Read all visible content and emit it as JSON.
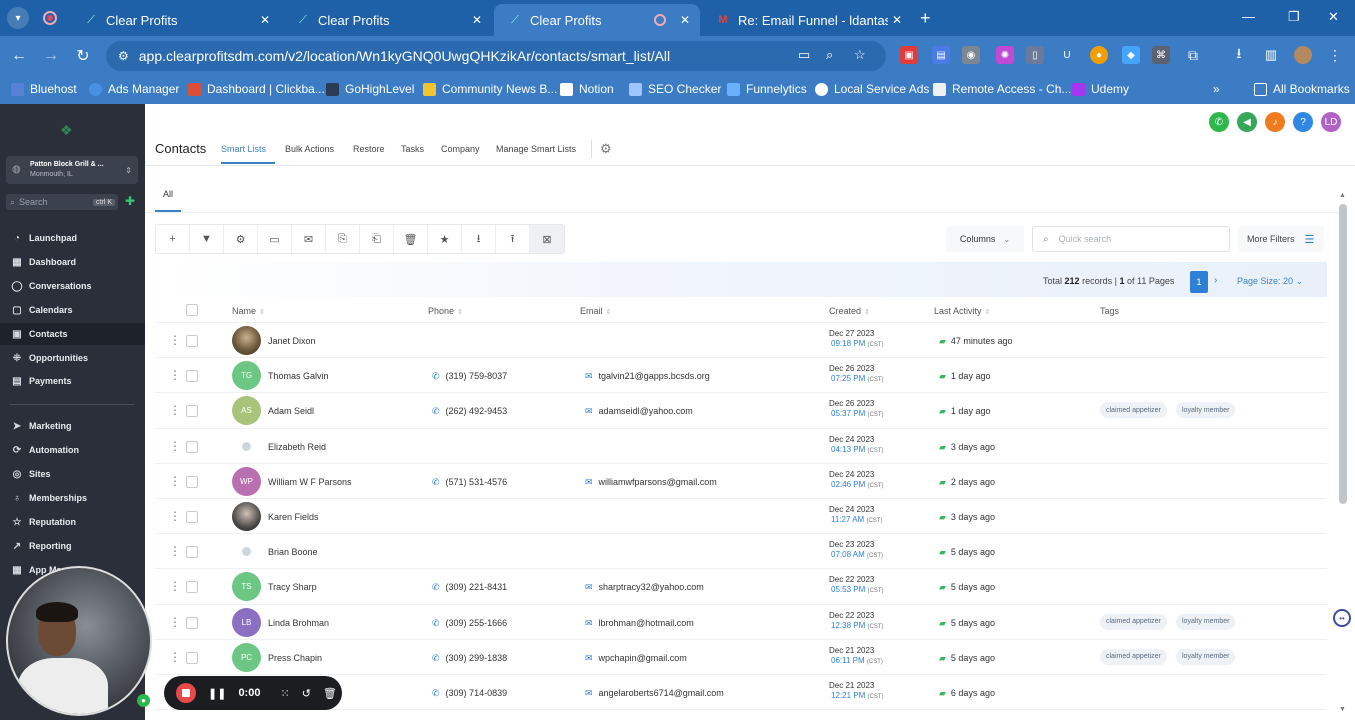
{
  "browser": {
    "tabs": [
      {
        "title": "Clear Profits",
        "active": false
      },
      {
        "title": "Clear Profits",
        "active": false
      },
      {
        "title": "Clear Profits",
        "active": true
      },
      {
        "title": "Re: Email Funnel - ldantas@clea",
        "active": false
      }
    ],
    "url": "app.clearprofitsdm.com/v2/location/Wn1kyGNQ0UwgQHKzikAr/contacts/smart_list/All",
    "bookmarks": [
      {
        "label": "Bluehost",
        "color": "#5a7fd6"
      },
      {
        "label": "Ads Manager",
        "color": "#4a90e2"
      },
      {
        "label": "Dashboard | Clickba...",
        "color": "#d94f3a"
      },
      {
        "label": "GoHighLevel",
        "color": "#2b3a55"
      },
      {
        "label": "Community News B...",
        "color": "#f1c232"
      },
      {
        "label": "Notion",
        "color": "#ffffff"
      },
      {
        "label": "SEO Checker",
        "color": "#9fc4ff"
      },
      {
        "label": "Funnelytics",
        "color": "#6ab0ff"
      },
      {
        "label": "Local Service Ads",
        "color": "#ffffff"
      },
      {
        "label": "Remote Access - Ch...",
        "color": "#f0f0f0"
      },
      {
        "label": "Udemy",
        "color": "#a435f0"
      }
    ],
    "all_bookmarks": "All Bookmarks"
  },
  "sidebar": {
    "location_name": "Patton Block Grill & ...",
    "location_city": "Monmouth, IL",
    "search_placeholder": "Search",
    "search_shortcut": "ctrl K",
    "items": [
      {
        "label": "Launchpad",
        "icon": "rocket-icon"
      },
      {
        "label": "Dashboard",
        "icon": "grid-icon"
      },
      {
        "label": "Conversations",
        "icon": "chat-icon"
      },
      {
        "label": "Calendars",
        "icon": "calendar-icon"
      },
      {
        "label": "Contacts",
        "icon": "contacts-icon",
        "active": true
      },
      {
        "label": "Opportunities",
        "icon": "funnel-icon"
      },
      {
        "label": "Payments",
        "icon": "receipt-icon"
      },
      {
        "label": "Marketing",
        "icon": "send-icon"
      },
      {
        "label": "Automation",
        "icon": "automation-icon"
      },
      {
        "label": "Sites",
        "icon": "globe-icon"
      },
      {
        "label": "Memberships",
        "icon": "badge-icon"
      },
      {
        "label": "Reputation",
        "icon": "star-icon"
      },
      {
        "label": "Reporting",
        "icon": "trend-icon"
      },
      {
        "label": "App Mar...",
        "icon": "apps-icon"
      }
    ]
  },
  "header": {
    "title": "Contacts",
    "tabs": [
      "Smart Lists",
      "Bulk Actions",
      "Restore",
      "Tasks",
      "Company",
      "Manage Smart Lists"
    ],
    "avatar_initials": "LD"
  },
  "subtabs": {
    "all": "All"
  },
  "controls": {
    "columns": "Columns",
    "quick_search_placeholder": "Quick search",
    "more_filters": "More Filters"
  },
  "pagination": {
    "total_prefix": "Total",
    "total_records": "212",
    "records_word": "records |",
    "current_page": "1",
    "of_pages": "of 11 Pages",
    "page_button": "1",
    "page_size": "Page Size: 20"
  },
  "table": {
    "headers": {
      "name": "Name",
      "phone": "Phone",
      "email": "Email",
      "created": "Created",
      "last_activity": "Last Activity",
      "tags": "Tags"
    },
    "rows": [
      {
        "initials": "",
        "avatar": "photo",
        "color": "",
        "name": "Janet Dixon",
        "phone": "",
        "email": "",
        "date": "Dec 27 2023",
        "time": "09:18 PM",
        "tz": "(CST)",
        "activity": "47 minutes ago",
        "tags": []
      },
      {
        "initials": "TG",
        "avatar": "initials",
        "color": "#6cc784",
        "name": "Thomas Galvin",
        "phone": "(319) 759-8037",
        "email": "tgalvin21@gapps.bcsds.org",
        "date": "Dec 26 2023",
        "time": "07:25 PM",
        "tz": "(CST)",
        "activity": "1 day ago",
        "tags": []
      },
      {
        "initials": "AS",
        "avatar": "initials",
        "color": "#a8c47a",
        "name": "Adam Seidl",
        "phone": "(262) 492-9453",
        "email": "adamseidl@yahoo.com",
        "date": "Dec 26 2023",
        "time": "05:37 PM",
        "tz": "(CST)",
        "activity": "1 day ago",
        "tags": [
          "claimed appetizer",
          "loyalty member"
        ]
      },
      {
        "initials": "",
        "avatar": "tiny",
        "color": "",
        "name": "Elizabeth Reid",
        "phone": "",
        "email": "",
        "date": "Dec 24 2023",
        "time": "04:13 PM",
        "tz": "(CST)",
        "activity": "3 days ago",
        "tags": []
      },
      {
        "initials": "WP",
        "avatar": "initials",
        "color": "#b96fb0",
        "name": "William W F Parsons",
        "phone": "(571) 531-4576",
        "email": "williamwfparsons@gmail.com",
        "date": "Dec 24 2023",
        "time": "02:46 PM",
        "tz": "(CST)",
        "activity": "2 days ago",
        "tags": []
      },
      {
        "initials": "",
        "avatar": "photo2",
        "color": "",
        "name": "Karen Fields",
        "phone": "",
        "email": "",
        "date": "Dec 24 2023",
        "time": "11:27 AM",
        "tz": "(CST)",
        "activity": "3 days ago",
        "tags": []
      },
      {
        "initials": "",
        "avatar": "tiny",
        "color": "",
        "name": "Brian Boone",
        "phone": "",
        "email": "",
        "date": "Dec 23 2023",
        "time": "07:08 AM",
        "tz": "(CST)",
        "activity": "5 days ago",
        "tags": []
      },
      {
        "initials": "TS",
        "avatar": "initials",
        "color": "#6cc784",
        "name": "Tracy Sharp",
        "phone": "(309) 221-8431",
        "email": "sharptracy32@yahoo.com",
        "date": "Dec 22 2023",
        "time": "05:53 PM",
        "tz": "(CST)",
        "activity": "5 days ago",
        "tags": []
      },
      {
        "initials": "LB",
        "avatar": "initials",
        "color": "#8b6fc2",
        "name": "Linda Brohman",
        "phone": "(309) 255-1666",
        "email": "lbrohman@hotmail.com",
        "date": "Dec 22 2023",
        "time": "12:38 PM",
        "tz": "(CST)",
        "activity": "5 days ago",
        "tags": [
          "claimed appetizer",
          "loyalty member"
        ]
      },
      {
        "initials": "PC",
        "avatar": "initials",
        "color": "#6cc784",
        "name": "Press Chapin",
        "phone": "(309) 299-1838",
        "email": "wpchapin@gmail.com",
        "date": "Dec 21 2023",
        "time": "06:11 PM",
        "tz": "(CST)",
        "activity": "5 days ago",
        "tags": [
          "claimed appetizer",
          "loyalty member"
        ]
      },
      {
        "initials": "",
        "avatar": "initials",
        "color": "#b96fb0",
        "name": "",
        "phone": "(309) 714-0839",
        "email": "angelaroberts6714@gmail.com",
        "date": "Dec 21 2023",
        "time": "12:21 PM",
        "tz": "(CST)",
        "activity": "6 days ago",
        "tags": []
      }
    ]
  },
  "recorder": {
    "timer": "0:00"
  }
}
